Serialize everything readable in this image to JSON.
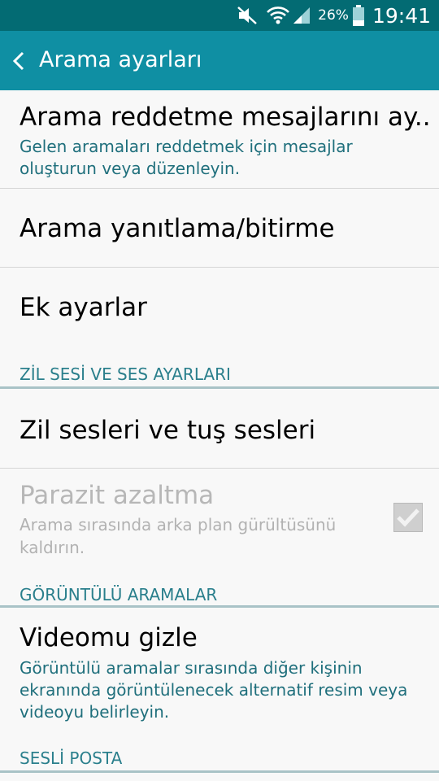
{
  "status_bar": {
    "battery_percent": "26%",
    "time": "19:41",
    "icons": [
      "mute-icon",
      "wifi-icon",
      "signal-icon",
      "battery-icon"
    ]
  },
  "app_bar": {
    "title": "Arama ayarları",
    "back_icon": "chevron-left-icon"
  },
  "list": {
    "reject_messages": {
      "title": "Arama reddetme mesajlarını ay..",
      "subtitle_line1": "Gelen aramaları reddetmek için mesajlar",
      "subtitle_line2": "oluşturun veya düzenleyin."
    },
    "answer_end": {
      "title": "Arama yanıtlama/bitirme"
    },
    "extra_settings": {
      "title": "Ek ayarlar"
    },
    "section_ringtone": "ZİL SESİ VE SES AYARLARI",
    "ringtones": {
      "title": "Zil sesleri ve tuş sesleri"
    },
    "noise_reduction": {
      "title": "Parazit azaltma",
      "subtitle_line1": "Arama sırasında arka plan gürültüsünü",
      "subtitle_line2": "kaldırın.",
      "checked": true,
      "enabled": false
    },
    "section_video": "GÖRÜNTÜLÜ ARAMALAR",
    "hide_video": {
      "title": "Videomu gizle",
      "subtitle_line1": "Görüntülü aramalar sırasında diğer kişinin",
      "subtitle_line2": "ekranında görüntülenecek alternatif resim veya",
      "subtitle_line3": "videoyu belirleyin."
    },
    "section_voicemail": "SESLİ POSTA"
  },
  "colors": {
    "status_bar": "#036b73",
    "app_bar": "#0f8fa3",
    "accent_text": "#1f6f7c"
  }
}
